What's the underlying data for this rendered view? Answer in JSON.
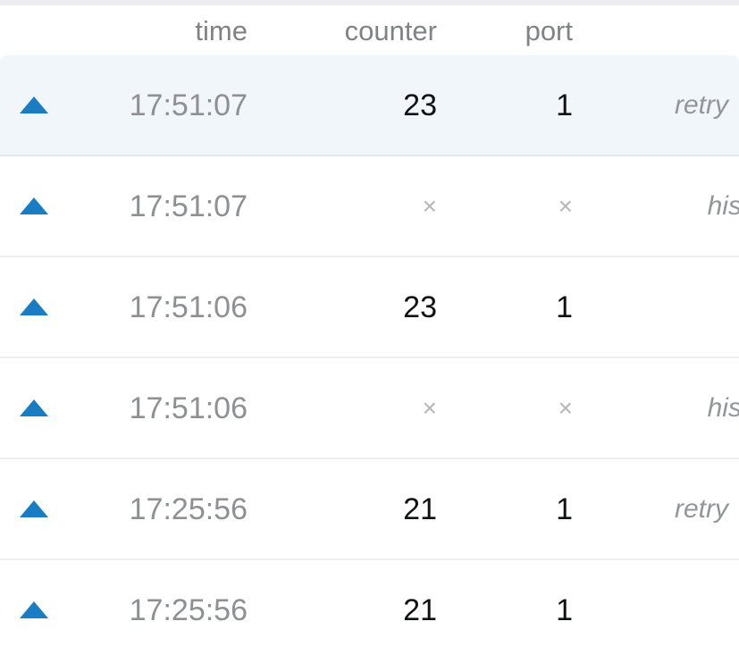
{
  "table": {
    "columns": [
      {
        "key": "expand",
        "label": ""
      },
      {
        "key": "time",
        "label": "time"
      },
      {
        "key": "counter",
        "label": "counter"
      },
      {
        "key": "port",
        "label": "port"
      },
      {
        "key": "status",
        "label": ""
      }
    ],
    "headers": {
      "expand": "",
      "time": "time",
      "counter": "counter",
      "port": "port",
      "status": ""
    },
    "empty_value": "×",
    "expand_icon": "triangle-up-icon",
    "accent_color": "#1a7dc4",
    "selected_row_color": "#f0f6f9",
    "rows": [
      {
        "time": "17:51:07",
        "counter": "23",
        "port": "1",
        "status": "retry",
        "selected": true
      },
      {
        "time": "17:51:07",
        "counter": "×",
        "port": "×",
        "status": "historical",
        "selected": false
      },
      {
        "time": "17:51:06",
        "counter": "23",
        "port": "1",
        "status": "",
        "selected": false
      },
      {
        "time": "17:51:06",
        "counter": "×",
        "port": "×",
        "status": "historical",
        "selected": false
      },
      {
        "time": "17:25:56",
        "counter": "21",
        "port": "1",
        "status": "retry",
        "selected": false
      },
      {
        "time": "17:25:56",
        "counter": "21",
        "port": "1",
        "status": "",
        "selected": false
      }
    ]
  }
}
